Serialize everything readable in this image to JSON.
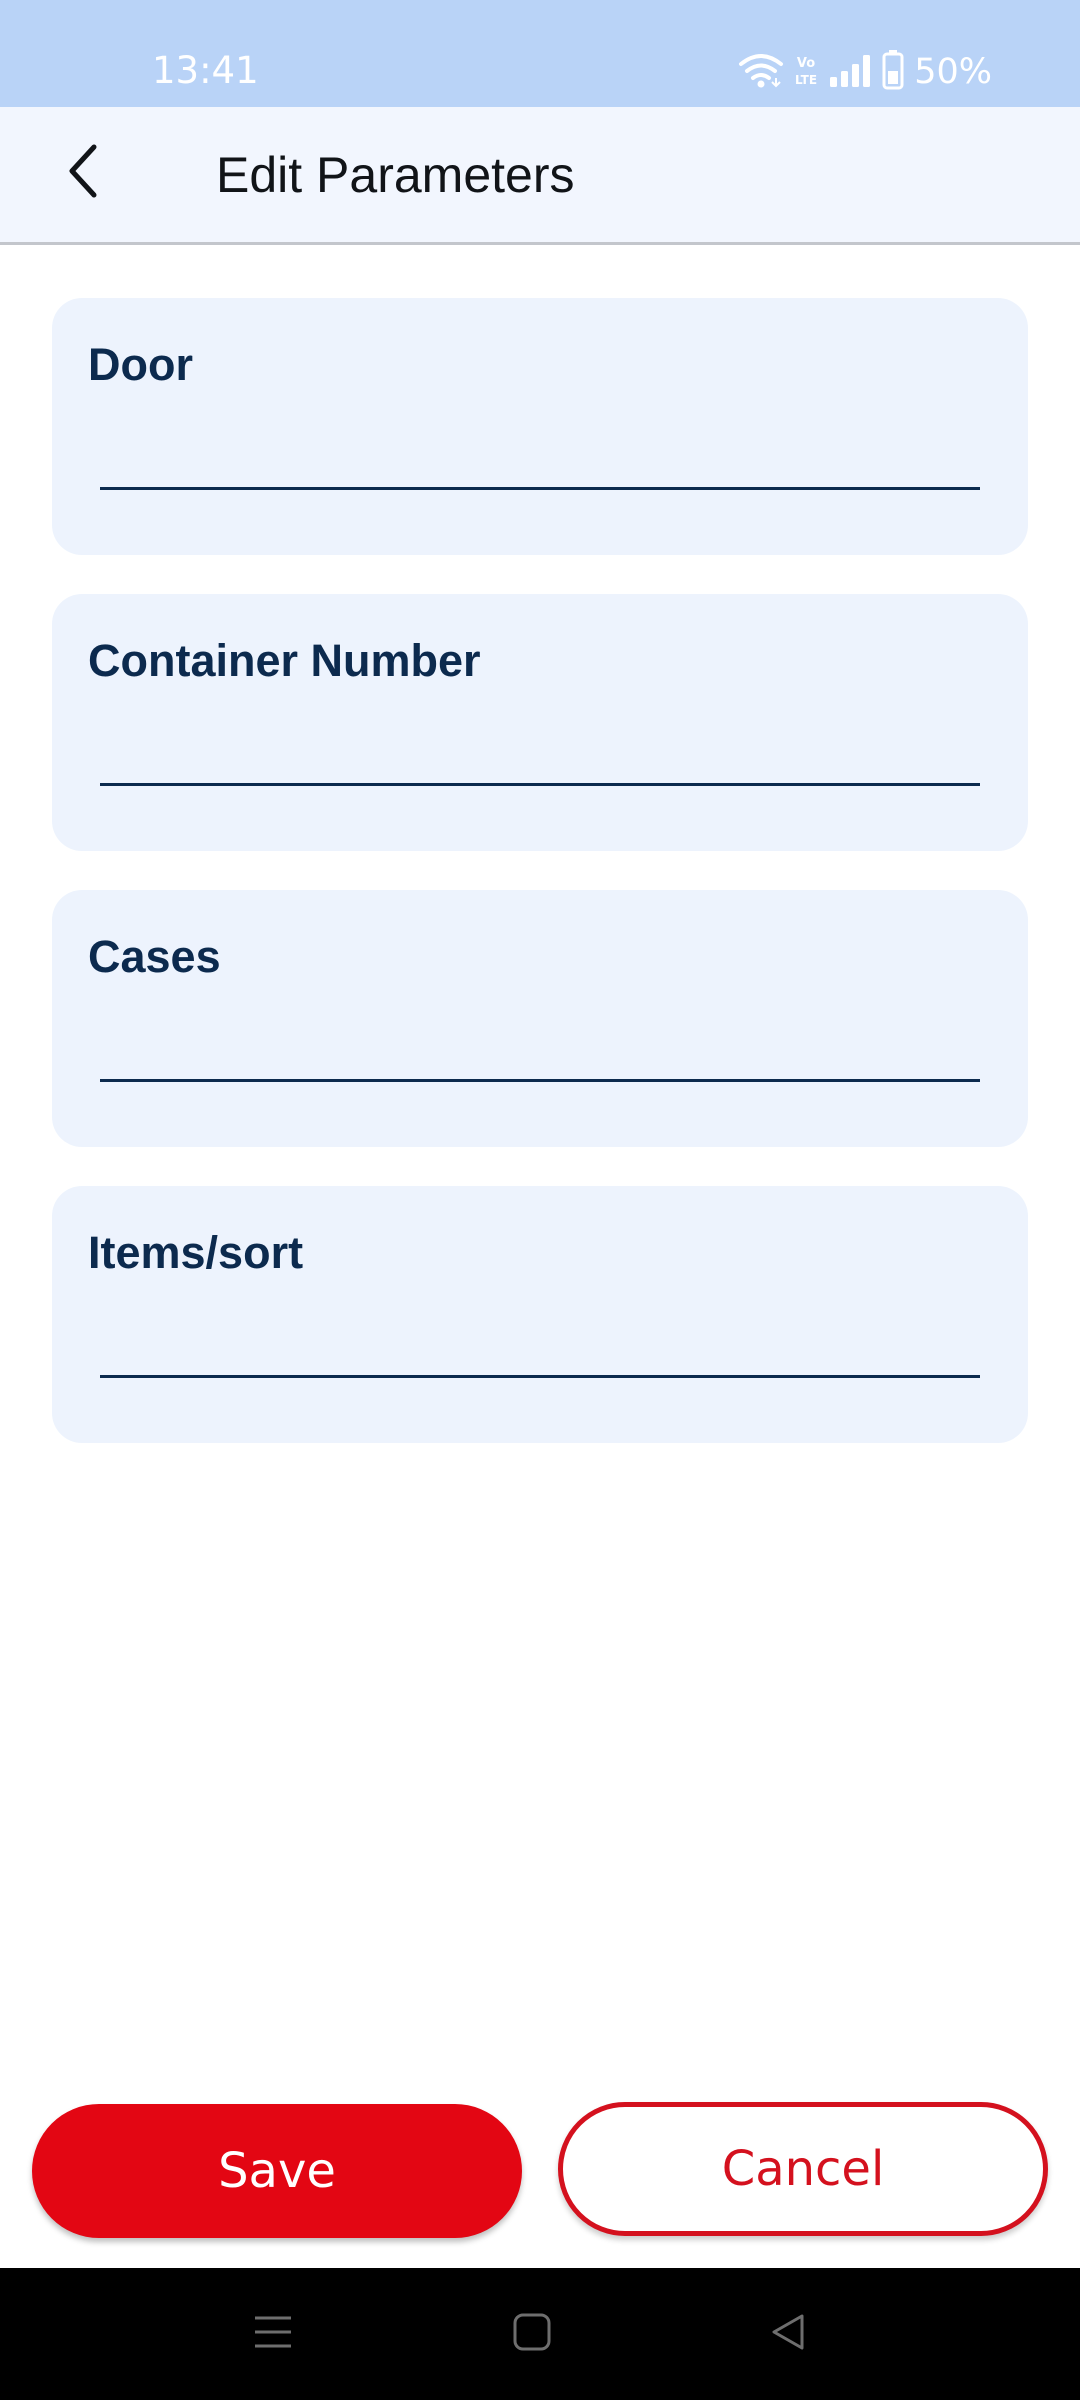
{
  "status_bar": {
    "time": "13:41",
    "battery": "50%",
    "volte": "Vo LTE",
    "icons": [
      "wifi-icon",
      "volte-icon",
      "signal-icon",
      "battery-icon"
    ]
  },
  "app_bar": {
    "title": "Edit Parameters",
    "back_icon": "chevron-left-icon"
  },
  "fields": [
    {
      "label": "Door",
      "value": ""
    },
    {
      "label": "Container Number",
      "value": ""
    },
    {
      "label": "Cases",
      "value": ""
    },
    {
      "label": "Items/sort",
      "value": ""
    }
  ],
  "actions": {
    "save_label": "Save",
    "cancel_label": "Cancel"
  },
  "nav_bar": {
    "icons": [
      "recents-icon",
      "home-icon",
      "back-triangle-icon"
    ]
  },
  "colors": {
    "status_bar_bg": "#b9d3f7",
    "app_bar_bg": "#f2f6fe",
    "card_bg": "#edf3fd",
    "label_text": "#0c2a4e",
    "primary_red": "#e30613"
  }
}
